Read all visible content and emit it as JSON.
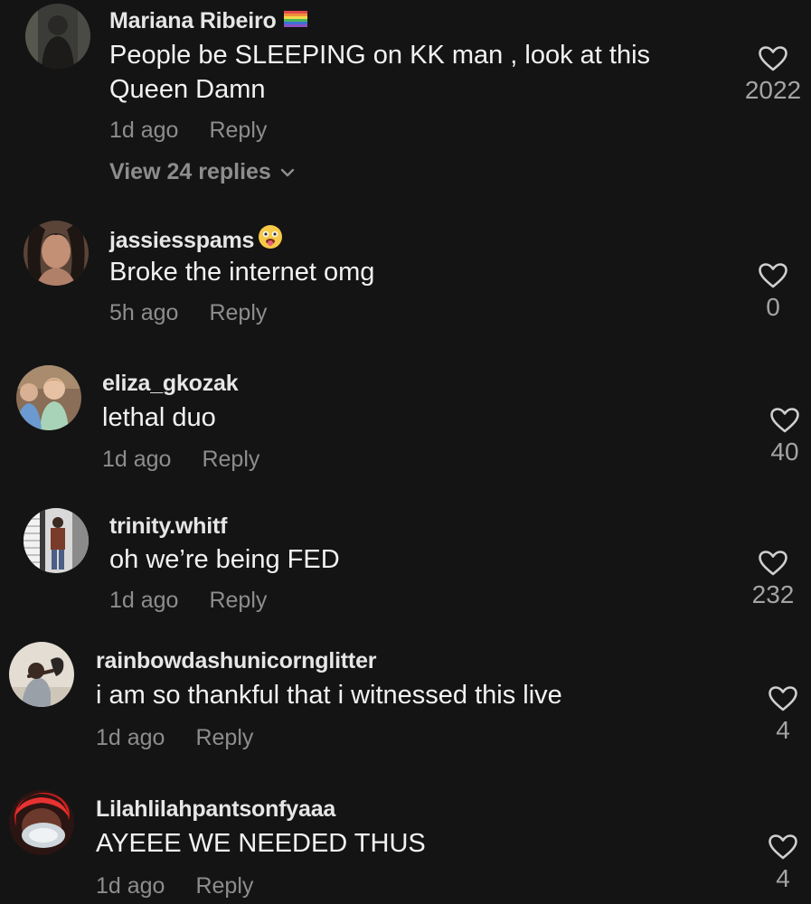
{
  "comments": [
    {
      "username": "Mariana Ribeiro",
      "badge": "rainbow-flag-icon",
      "text_lines": [
        "People be SLEEPING on KK man , look at this",
        "Queen Damn"
      ],
      "time": "1d ago",
      "reply_label": "Reply",
      "likes": "2022",
      "view_replies": "View 24 replies"
    },
    {
      "username": "jassiesspams",
      "badge": "tongue-out-emoji-icon",
      "text_lines": [
        "Broke the internet omg"
      ],
      "time": "5h ago",
      "reply_label": "Reply",
      "likes": "0"
    },
    {
      "username": "eliza_gkozak",
      "text_lines": [
        "lethal duo"
      ],
      "time": "1d ago",
      "reply_label": "Reply",
      "likes": "40"
    },
    {
      "username": "trinity.whitf",
      "text_lines": [
        "oh we’re being FED"
      ],
      "time": "1d ago",
      "reply_label": "Reply",
      "likes": "232"
    },
    {
      "username": "rainbowdashunicornglitter",
      "text_lines": [
        "i am so thankful that i witnessed this live"
      ],
      "time": "1d ago",
      "reply_label": "Reply",
      "likes": "4"
    },
    {
      "username": "Lilahlilahpantsonfyaaa",
      "text_lines": [
        "AYEEE WE NEEDED THUS"
      ],
      "time": "1d ago",
      "reply_label": "Reply",
      "likes": "4"
    }
  ],
  "colors": {
    "background": "#141414",
    "primary_text": "#f2f2f2",
    "secondary_text": "#8d8d8d"
  }
}
